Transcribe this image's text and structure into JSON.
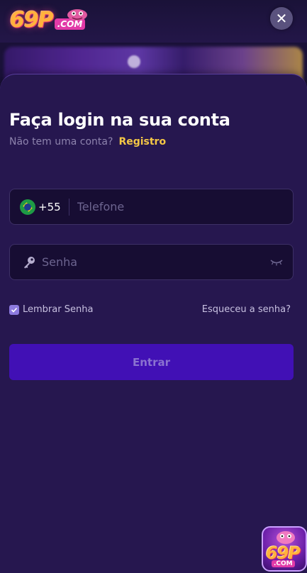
{
  "logo": {
    "number": "69P",
    "suffix": ".COM"
  },
  "header": {
    "close_symbol": "✕"
  },
  "sheet": {
    "title": "Faça login na sua conta",
    "subtitle": "Não tem uma conta?",
    "register_link": "Registro"
  },
  "phone": {
    "country_code": "+55",
    "placeholder": "Telefone",
    "value": ""
  },
  "password": {
    "placeholder": "Senha",
    "value": ""
  },
  "options": {
    "remember_label": "Lembrar Senha",
    "remember_checked": true,
    "forgot_label": "Esqueceu a senha?"
  },
  "submit_label": "Entrar",
  "app_badge": {
    "number": "69P",
    "suffix": ".COM"
  },
  "icons": {
    "close": "close-icon",
    "flag": "brazil-flag-icon",
    "key": "key-icon",
    "eye": "eye-closed-icon",
    "check": "check-icon"
  },
  "colors": {
    "sheet_bg": "#26174f",
    "accent_link": "#f4c745",
    "button_bg": "#4110b5",
    "button_text": "#8a72d0",
    "field_bg": "#170d33",
    "checkbox": "#8d7be0"
  }
}
